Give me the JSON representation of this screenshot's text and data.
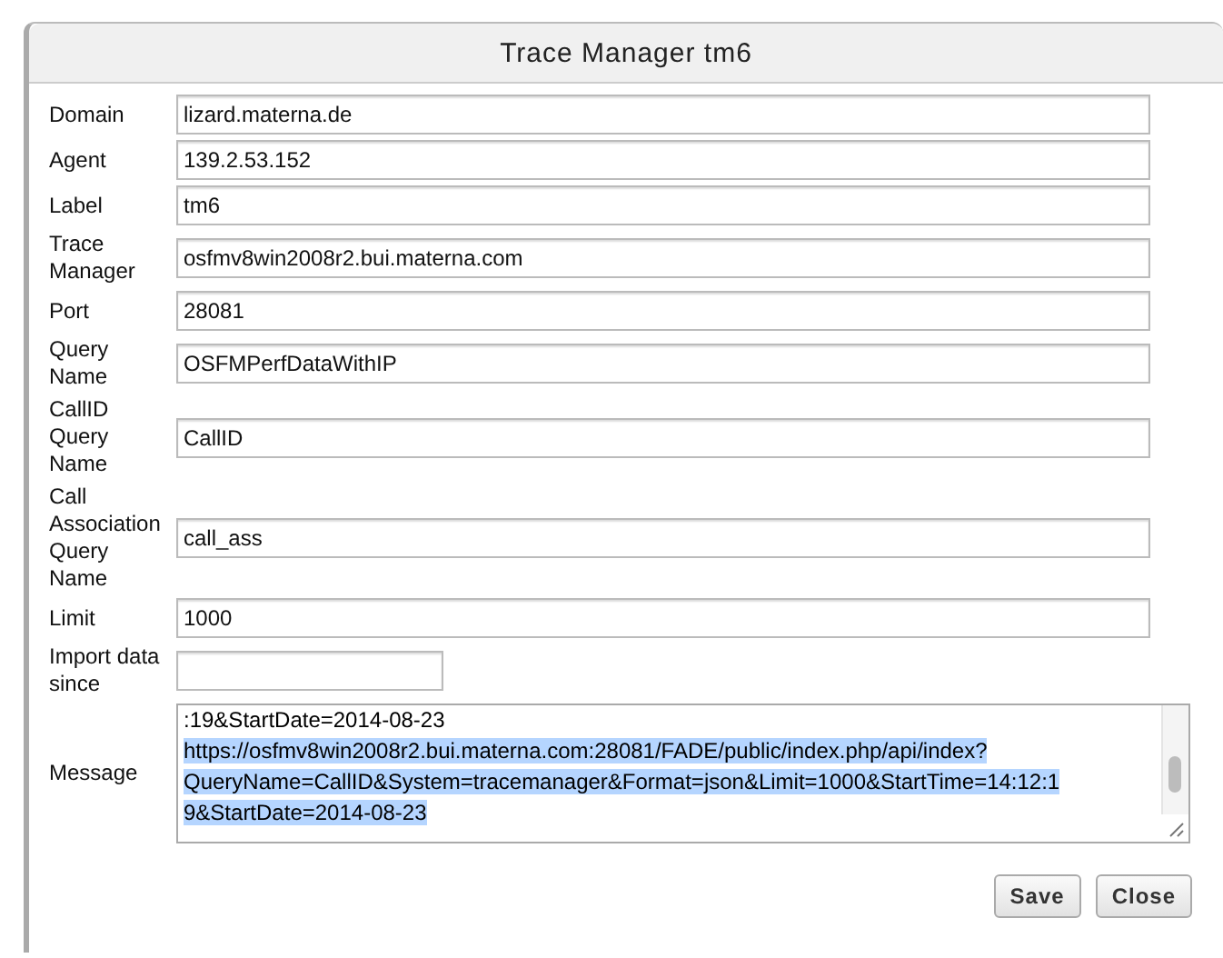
{
  "dialog": {
    "title": "Trace Manager tm6"
  },
  "fields": [
    {
      "label": "Domain",
      "value": "lizard.materna.de",
      "kind": "wide"
    },
    {
      "label": "Agent",
      "value": "139.2.53.152",
      "kind": "wide"
    },
    {
      "label": "Label",
      "value": "tm6",
      "kind": "wide"
    },
    {
      "label": "Trace Manager",
      "value": "osfmv8win2008r2.bui.materna.com",
      "kind": "wide"
    },
    {
      "label": "Port",
      "value": "28081",
      "kind": "wide"
    },
    {
      "label": "Query Name",
      "value": "OSFMPerfDataWithIP",
      "kind": "wide"
    },
    {
      "label": "CallID Query Name",
      "value": "CallID",
      "kind": "wide"
    },
    {
      "label": "Call Association Query Name",
      "value": "call_ass",
      "kind": "wide"
    },
    {
      "label": "Limit",
      "value": "1000",
      "kind": "wide"
    },
    {
      "label": "Import data since",
      "kind": "short"
    }
  ],
  "message": {
    "label": "Message",
    "lines": [
      {
        "text": ":19&StartDate=2014-08-23",
        "selected": false
      },
      {
        "text": "https://osfmv8win2008r2.bui.materna.com:28081/FADE/public/index.php/api/index?",
        "selected": true
      },
      {
        "text": "QueryName=CallID&System=tracemanager&Format=json&Limit=1000&StartTime=14:12:1",
        "selected": true
      },
      {
        "text": "9&StartDate=2014-08-23",
        "selected": true
      }
    ]
  },
  "buttons": [
    "Save",
    "Close"
  ]
}
